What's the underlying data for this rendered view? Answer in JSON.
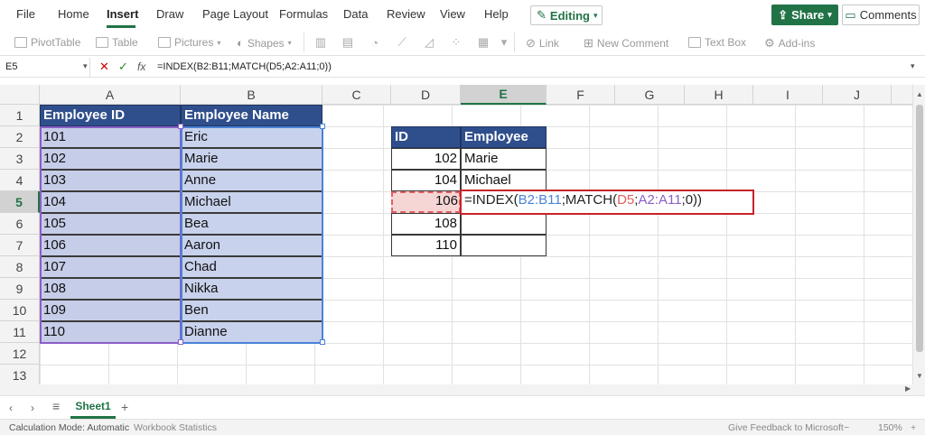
{
  "menu": {
    "items": [
      "File",
      "Home",
      "Insert",
      "Draw",
      "Page Layout",
      "Formulas",
      "Data",
      "Review",
      "View",
      "Help"
    ],
    "active": "Insert",
    "editing_label": "Editing",
    "share_label": "Share",
    "comments_label": "Comments"
  },
  "ribbon": {
    "pivottable": "PivotTable",
    "table": "Table",
    "pictures": "Pictures",
    "shapes": "Shapes",
    "link": "Link",
    "new_comment": "New Comment",
    "text_box": "Text Box",
    "addins": "Add-ins"
  },
  "formula_bar": {
    "name_box": "E5",
    "formula": "=INDEX(B2:B11;MATCH(D5;A2:A11;0))"
  },
  "columns": [
    "A",
    "B",
    "C",
    "D",
    "E",
    "F",
    "G",
    "H",
    "I",
    "J"
  ],
  "rows": [
    "1",
    "2",
    "3",
    "4",
    "5",
    "6",
    "7",
    "8",
    "9",
    "10",
    "11",
    "12",
    "13"
  ],
  "table_main": {
    "header_id": "Employee ID",
    "header_name": "Employee Name",
    "ids": [
      "101",
      "102",
      "103",
      "104",
      "105",
      "106",
      "107",
      "108",
      "109",
      "110"
    ],
    "names": [
      "Eric",
      "Marie",
      "Anne",
      "Michael",
      "Bea",
      "Aaron",
      "Chad",
      "Nikka",
      "Ben",
      "Dianne"
    ]
  },
  "table_lookup": {
    "header_id": "ID",
    "header_employee": "Employee",
    "ids": [
      "102",
      "104",
      "106",
      "108",
      "110"
    ],
    "results": [
      "Marie",
      "Michael",
      "",
      "",
      ""
    ]
  },
  "active_formula": {
    "prefix": "=INDEX(",
    "ref1": "B2:B11",
    "mid": ";MATCH(",
    "ref2": "D5",
    "sep": ";",
    "ref3": "A2:A11",
    "suffix": ";0))"
  },
  "sheet_tabs": {
    "active": "Sheet1"
  },
  "status": {
    "calc_mode": "Calculation Mode: Automatic",
    "workbook_stats": "Workbook Statistics",
    "feedback": "Give Feedback to Microsoft",
    "zoom": "150%"
  }
}
